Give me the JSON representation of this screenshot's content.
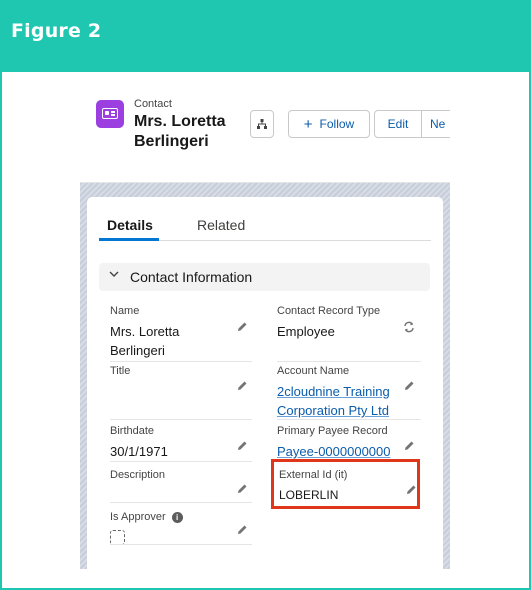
{
  "figure": {
    "title": "Figure 2"
  },
  "header": {
    "object_label": "Contact",
    "record_name": "Mrs. Loretta Berlingeri",
    "follow_label": "Follow",
    "edit_label": "Edit",
    "new_label": "Ne"
  },
  "tabs": [
    {
      "label": "Details",
      "active": true
    },
    {
      "label": "Related",
      "active": false
    }
  ],
  "section": {
    "title": "Contact Information"
  },
  "fields": {
    "name": {
      "label": "Name",
      "value": "Mrs. Loretta Berlingeri"
    },
    "contact_record_type": {
      "label": "Contact Record Type",
      "value": "Employee"
    },
    "title": {
      "label": "Title",
      "value": ""
    },
    "account_name": {
      "label": "Account Name",
      "value": "2cloudnine Training Corporation Pty Ltd"
    },
    "birthdate": {
      "label": "Birthdate",
      "value": "30/1/1971"
    },
    "primary_payee": {
      "label": "Primary Payee Record",
      "value": "Payee-0000000000"
    },
    "description": {
      "label": "Description",
      "value": ""
    },
    "external_id": {
      "label": "External Id (it)",
      "value": "LOBERLIN"
    },
    "is_approver": {
      "label": "Is Approver",
      "checked": false
    }
  },
  "colors": {
    "accent_teal": "#1fc7b0",
    "link_blue": "#0b5cab",
    "highlight_red": "#e0371b",
    "object_icon_purple": "#9b3fe0"
  }
}
